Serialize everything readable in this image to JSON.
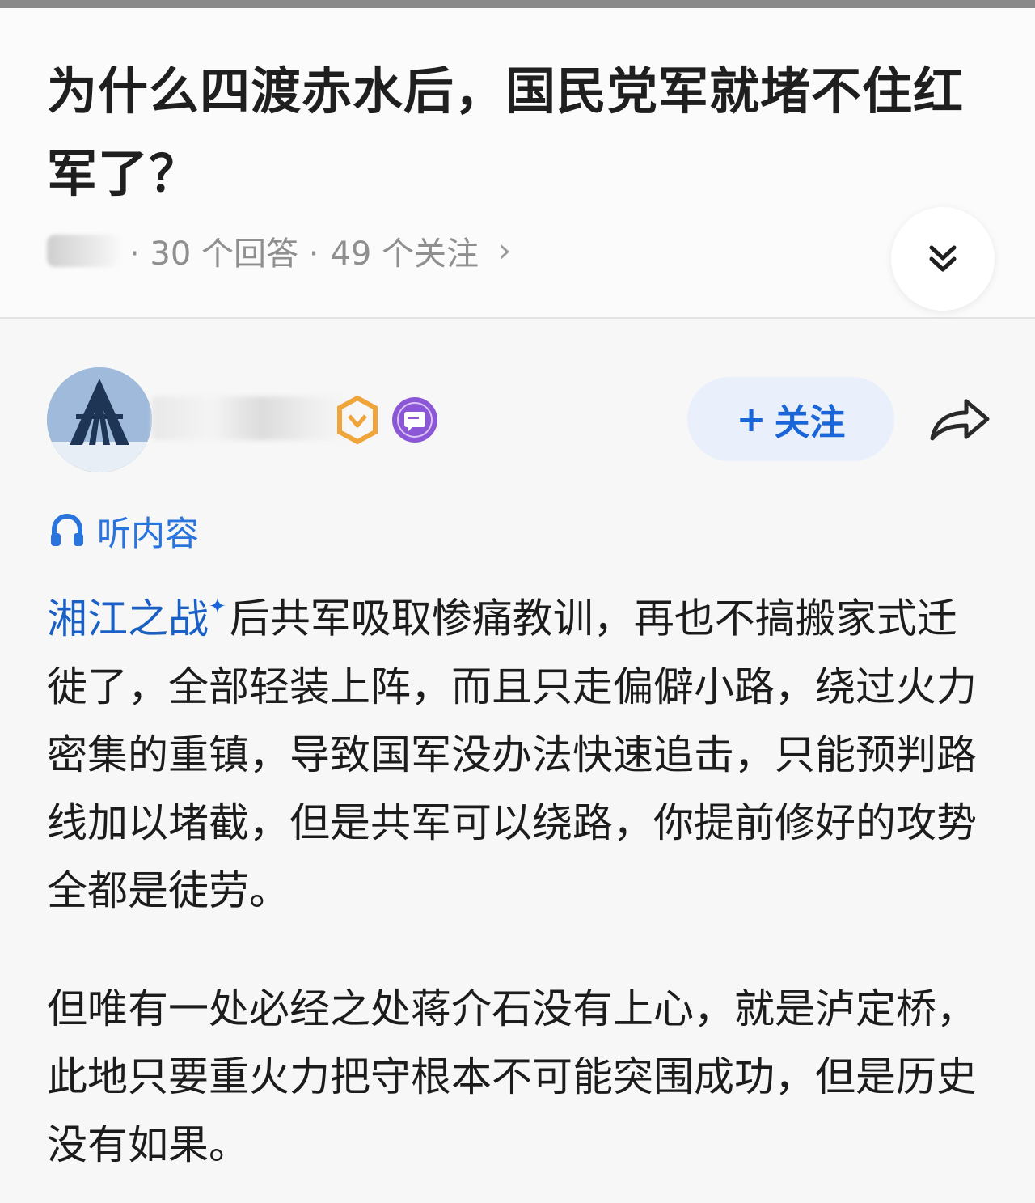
{
  "question": {
    "title": "为什么四渡赤水后，国民党军就堵不住红军了？",
    "meta_answers": "· 30 个回答 ·",
    "meta_follows": "49 个关注",
    "meta_chevron": "›"
  },
  "author": {
    "follow_plus": "+",
    "follow_label": "关注"
  },
  "listen": {
    "label": "听内容"
  },
  "answer": {
    "p1_link": "湘江之战",
    "p1_link_marker": "✦",
    "p1_rest": "后共军吸取惨痛教训，再也不搞搬家式迁徙了，全部轻装上阵，而且只走偏僻小路，绕过火力密集的重镇，导致国军没办法快速追击，只能预判路线加以堵截，但是共军可以绕路，你提前修好的攻势全都是徒劳。",
    "p2": "但唯有一处必经之处蒋介石没有上心，就是泸定桥，此地只要重火力把守根本不可能突围成功，但是历史没有如果。"
  },
  "colors": {
    "accent_blue": "#1a66d8",
    "follow_bg": "#e9f0fb",
    "level_badge": "#f0a53a",
    "creator_badge": "#8b57d6"
  },
  "icons": {
    "expand": "double-chevron-down-icon",
    "share": "share-arrow-icon",
    "listen": "headphones-icon",
    "level": "level-badge-icon",
    "creator": "creator-badge-icon"
  }
}
